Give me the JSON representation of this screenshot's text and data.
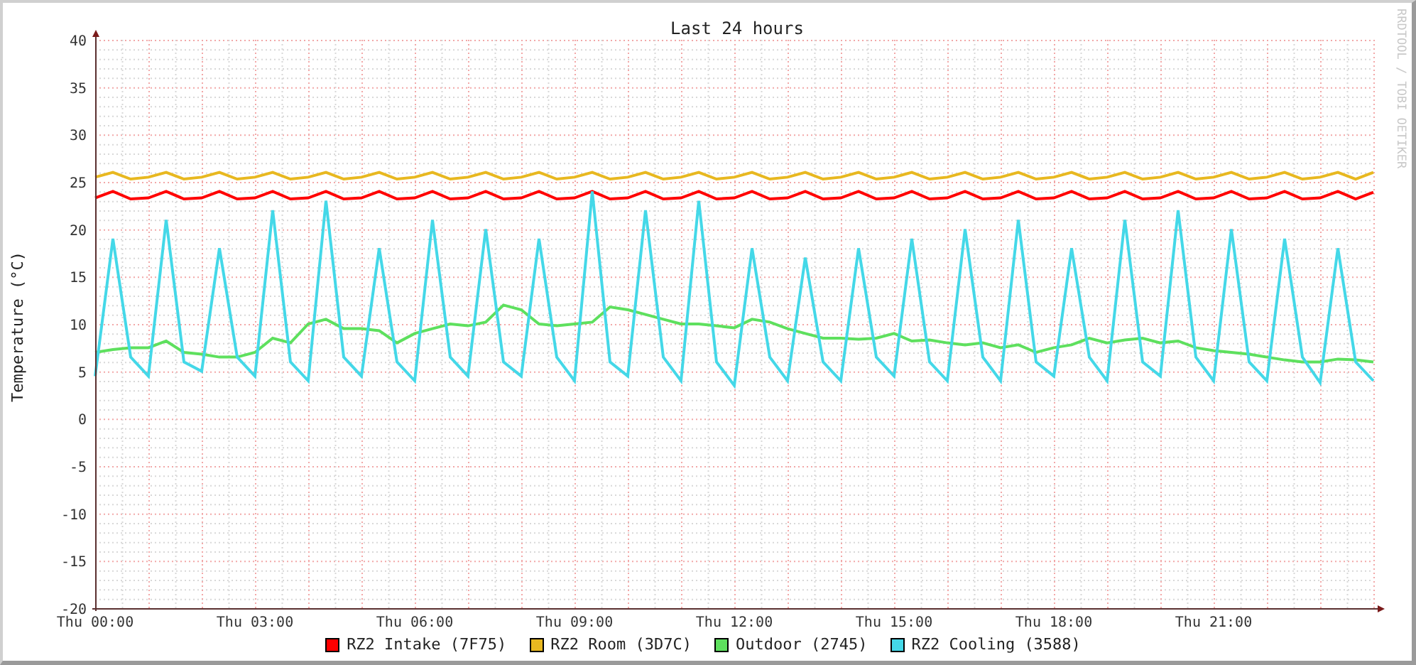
{
  "credit": "RRDTOOL / TOBI OETIKER",
  "chart_data": {
    "type": "line",
    "title": "Last 24 hours",
    "ylabel": "Temperature (°C)",
    "grid": true,
    "ylim": [
      -20,
      40
    ],
    "yticks": [
      -20,
      -15,
      -10,
      -5,
      0,
      5,
      10,
      15,
      20,
      25,
      30,
      35,
      40
    ],
    "categories": [
      "Thu 00:00",
      null,
      null,
      null,
      null,
      null,
      null,
      null,
      null,
      "Thu 03:00",
      null,
      null,
      null,
      null,
      null,
      null,
      null,
      null,
      "Thu 06:00",
      null,
      null,
      null,
      null,
      null,
      null,
      null,
      null,
      "Thu 09:00",
      null,
      null,
      null,
      null,
      null,
      null,
      null,
      null,
      "Thu 12:00",
      null,
      null,
      null,
      null,
      null,
      null,
      null,
      null,
      "Thu 15:00",
      null,
      null,
      null,
      null,
      null,
      null,
      null,
      null,
      "Thu 18:00",
      null,
      null,
      null,
      null,
      null,
      null,
      null,
      null,
      "Thu 21:00",
      null,
      null,
      null,
      null,
      null,
      null,
      null,
      null,
      null
    ],
    "series": [
      {
        "name": "RZ2 Intake (7F75)",
        "color": "#ff0000",
        "values": [
          23.3,
          24.0,
          23.2,
          23.3,
          24.0,
          23.2,
          23.3,
          24.0,
          23.2,
          23.3,
          24.0,
          23.2,
          23.3,
          24.0,
          23.2,
          23.3,
          24.0,
          23.2,
          23.3,
          24.0,
          23.2,
          23.3,
          24.0,
          23.2,
          23.3,
          24.0,
          23.2,
          23.3,
          24.0,
          23.2,
          23.3,
          24.0,
          23.2,
          23.3,
          24.0,
          23.2,
          23.3,
          24.0,
          23.2,
          23.3,
          24.0,
          23.2,
          23.3,
          24.0,
          23.2,
          23.3,
          24.0,
          23.2,
          23.3,
          24.0,
          23.2,
          23.3,
          24.0,
          23.2,
          23.3,
          24.0,
          23.2,
          23.3,
          24.0,
          23.2,
          23.3,
          24.0,
          23.2,
          23.3,
          24.0,
          23.2,
          23.3,
          24.0,
          23.2,
          23.3,
          24.0,
          23.2,
          23.9
        ]
      },
      {
        "name": "RZ2 Room (3D7C)",
        "color": "#e8b820",
        "values": [
          25.5,
          26.0,
          25.3,
          25.5,
          26.0,
          25.3,
          25.5,
          26.0,
          25.3,
          25.5,
          26.0,
          25.3,
          25.5,
          26.0,
          25.3,
          25.5,
          26.0,
          25.3,
          25.5,
          26.0,
          25.3,
          25.5,
          26.0,
          25.3,
          25.5,
          26.0,
          25.3,
          25.5,
          26.0,
          25.3,
          25.5,
          26.0,
          25.3,
          25.5,
          26.0,
          25.3,
          25.5,
          26.0,
          25.3,
          25.5,
          26.0,
          25.3,
          25.5,
          26.0,
          25.3,
          25.5,
          26.0,
          25.3,
          25.5,
          26.0,
          25.3,
          25.5,
          26.0,
          25.3,
          25.5,
          26.0,
          25.3,
          25.5,
          26.0,
          25.3,
          25.5,
          26.0,
          25.3,
          25.5,
          26.0,
          25.3,
          25.5,
          26.0,
          25.3,
          25.5,
          26.0,
          25.3,
          26.0
        ]
      },
      {
        "name": "Outdoor (2745)",
        "color": "#5ee05e",
        "values": [
          7,
          7.3,
          7.5,
          7.5,
          8.2,
          7,
          6.8,
          6.5,
          6.5,
          7,
          8.5,
          8,
          10,
          10.5,
          9.5,
          9.5,
          9.3,
          8,
          9,
          9.5,
          10,
          9.8,
          10.2,
          12,
          11.5,
          10,
          9.8,
          10,
          10.2,
          11.8,
          11.5,
          11,
          10.5,
          10,
          10,
          9.8,
          9.6,
          10.5,
          10.2,
          9.5,
          9,
          8.5,
          8.5,
          8.4,
          8.5,
          9,
          8.2,
          8.3,
          8,
          7.8,
          8,
          7.5,
          7.8,
          7,
          7.5,
          7.8,
          8.5,
          8,
          8.3,
          8.5,
          8,
          8.2,
          7.5,
          7.2,
          7,
          6.8,
          6.5,
          6.2,
          6,
          6,
          6.3,
          6.2,
          6
        ]
      },
      {
        "name": "RZ2 Cooling (3588)",
        "color": "#44d8e8",
        "values": [
          4.5,
          19,
          6.5,
          4.5,
          21,
          6,
          5,
          18,
          6.5,
          4.5,
          22,
          6,
          4,
          23,
          6.5,
          4.5,
          18,
          6,
          4,
          21,
          6.5,
          4.5,
          20,
          6,
          4.5,
          19,
          6.5,
          4,
          24,
          6,
          4.5,
          22,
          6.5,
          4,
          23,
          6,
          3.5,
          18,
          6.5,
          4,
          17,
          6,
          4,
          18,
          6.5,
          4.5,
          19,
          6,
          4,
          20,
          6.5,
          4,
          21,
          6,
          4.5,
          18,
          6.5,
          4,
          21,
          6,
          4.5,
          22,
          6.5,
          4,
          20,
          6,
          4,
          19,
          6.5,
          3.8,
          18,
          6,
          4
        ]
      }
    ]
  }
}
